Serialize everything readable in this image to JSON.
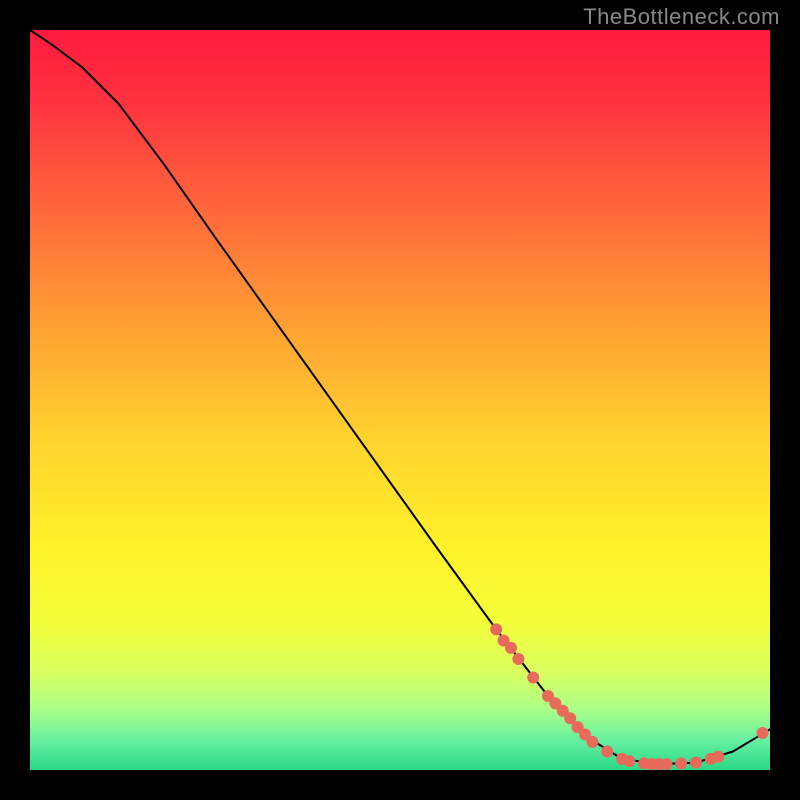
{
  "watermark": "TheBottleneck.com",
  "chart_data": {
    "type": "line",
    "title": "",
    "xlabel": "",
    "ylabel": "",
    "xlim": [
      0,
      100
    ],
    "ylim": [
      0,
      100
    ],
    "background_gradient": {
      "stops": [
        {
          "offset": 0.0,
          "color": "#ff1a3d"
        },
        {
          "offset": 0.1,
          "color": "#ff3340"
        },
        {
          "offset": 0.25,
          "color": "#ff6a3a"
        },
        {
          "offset": 0.4,
          "color": "#ffa033"
        },
        {
          "offset": 0.55,
          "color": "#ffd22e"
        },
        {
          "offset": 0.7,
          "color": "#fff22a"
        },
        {
          "offset": 0.8,
          "color": "#f4ff3a"
        },
        {
          "offset": 0.87,
          "color": "#d8ff60"
        },
        {
          "offset": 0.92,
          "color": "#a8ff88"
        },
        {
          "offset": 0.96,
          "color": "#66f0a0"
        },
        {
          "offset": 1.0,
          "color": "#29d886"
        }
      ]
    },
    "curve": [
      {
        "x": 0,
        "y": 100
      },
      {
        "x": 3,
        "y": 98
      },
      {
        "x": 7,
        "y": 95
      },
      {
        "x": 12,
        "y": 90
      },
      {
        "x": 18,
        "y": 82
      },
      {
        "x": 25,
        "y": 72
      },
      {
        "x": 35,
        "y": 58
      },
      {
        "x": 45,
        "y": 44
      },
      {
        "x": 55,
        "y": 30
      },
      {
        "x": 63,
        "y": 19
      },
      {
        "x": 70,
        "y": 10
      },
      {
        "x": 76,
        "y": 4
      },
      {
        "x": 80,
        "y": 1.5
      },
      {
        "x": 85,
        "y": 0.8
      },
      {
        "x": 90,
        "y": 1.0
      },
      {
        "x": 95,
        "y": 2.5
      },
      {
        "x": 100,
        "y": 5.5
      }
    ],
    "dots": [
      {
        "x": 63,
        "y": 19
      },
      {
        "x": 64,
        "y": 17.5
      },
      {
        "x": 65,
        "y": 16.5
      },
      {
        "x": 66,
        "y": 15
      },
      {
        "x": 68,
        "y": 12.5
      },
      {
        "x": 70,
        "y": 10
      },
      {
        "x": 71,
        "y": 9
      },
      {
        "x": 72,
        "y": 8
      },
      {
        "x": 73,
        "y": 7
      },
      {
        "x": 74,
        "y": 5.8
      },
      {
        "x": 75,
        "y": 4.8
      },
      {
        "x": 76,
        "y": 3.8
      },
      {
        "x": 78,
        "y": 2.5
      },
      {
        "x": 80,
        "y": 1.5
      },
      {
        "x": 81,
        "y": 1.2
      },
      {
        "x": 83,
        "y": 0.9
      },
      {
        "x": 84,
        "y": 0.8
      },
      {
        "x": 85,
        "y": 0.8
      },
      {
        "x": 86,
        "y": 0.8
      },
      {
        "x": 88,
        "y": 0.9
      },
      {
        "x": 90,
        "y": 1.0
      },
      {
        "x": 92,
        "y": 1.5
      },
      {
        "x": 93,
        "y": 1.8
      },
      {
        "x": 99,
        "y": 5.0
      }
    ],
    "dot_color": "#e86a5a",
    "line_color": "#000000"
  }
}
